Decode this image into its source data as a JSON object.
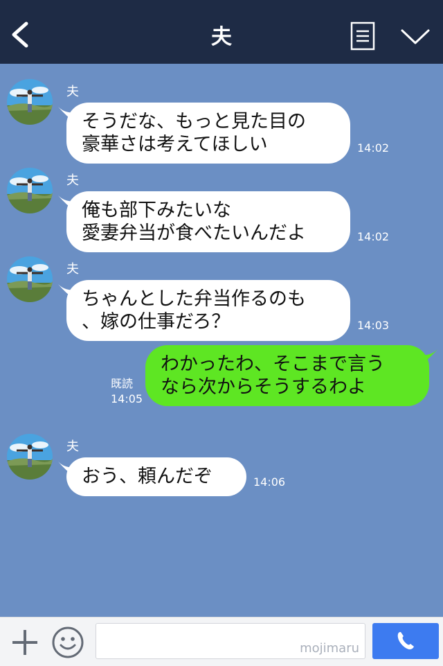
{
  "header": {
    "title": "夫"
  },
  "messages": [
    {
      "side": "left",
      "sender": "夫",
      "text": "そうだな、もっと見た目の\n豪華さは考えてほしい",
      "time": "14:02"
    },
    {
      "side": "left",
      "sender": "夫",
      "text": "俺も部下みたいな\n愛妻弁当が食べたいんだよ",
      "time": "14:02"
    },
    {
      "side": "left",
      "sender": "夫",
      "text": "ちゃんとした弁当作るのも\n、嫁の仕事だろ？",
      "time": "14:03"
    },
    {
      "side": "right",
      "text": "わかったわ、そこまで言う\nなら次からそうするわよ",
      "read": "既読",
      "time": "14:05"
    },
    {
      "side": "left",
      "sender": "夫",
      "text": "おう、頼んだぞ",
      "time": "14:06"
    }
  ],
  "footer": {
    "watermark": "mojimaru"
  },
  "colors": {
    "header_bg": "#1e2b45",
    "chat_bg": "#6b8fc4",
    "my_bubble": "#5ee623",
    "call_button": "#3d7bf0"
  }
}
